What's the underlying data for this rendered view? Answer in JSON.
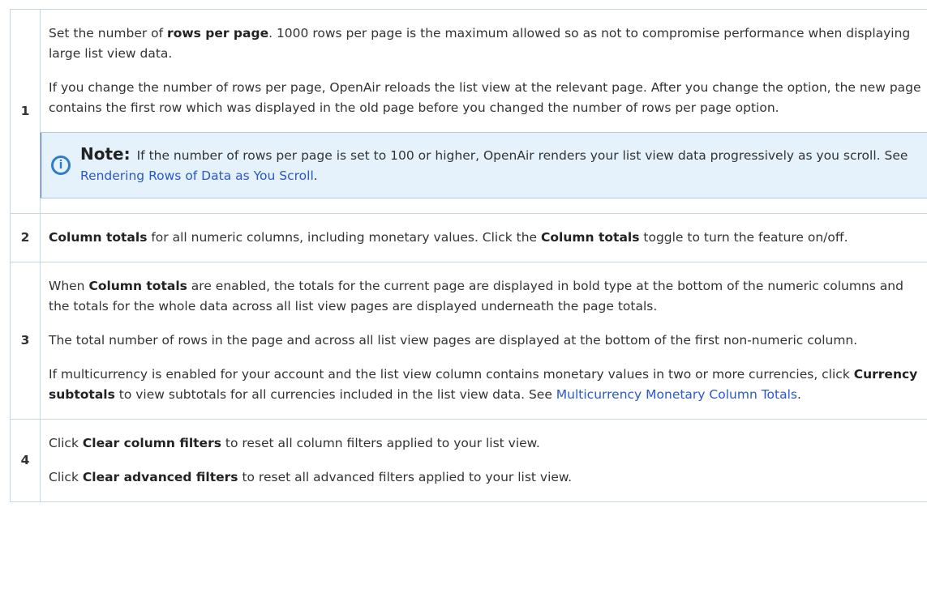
{
  "rows": [
    {
      "number": "1",
      "p1_pre": "Set the number of ",
      "p1_bold": "rows per page",
      "p1_post": ". 1000 rows per page is the maximum allowed so as not to compromise performance when displaying large list view data.",
      "p2": "If you change the number of rows per page, OpenAir reloads the list view at the relevant page. After you change the option, the new page contains the first row which was displayed in the old page before you changed the number of rows per page option.",
      "note": {
        "icon": "info-circle-icon",
        "label": "Note:",
        "text": "If the number of rows per page is set to 100 or higher, OpenAir renders your list view data progressively as you scroll. See ",
        "link": "Rendering Rows of Data as You Scroll",
        "end": "."
      }
    },
    {
      "number": "2",
      "bold1": "Column totals",
      "mid": " for all numeric columns, including monetary values. Click the ",
      "bold2": "Column totals",
      "post": " toggle to turn the feature on/off."
    },
    {
      "number": "3",
      "p1_pre": "When ",
      "p1_bold": "Column totals",
      "p1_post": " are enabled, the totals for the current page are displayed in bold type at the bottom of the numeric columns and the totals for the whole data across all list view pages are displayed underneath the page totals.",
      "p2": "The total number of rows in the page and across all list view pages are displayed at the bottom of the first non-numeric column.",
      "p3_pre": "If multicurrency is enabled for your account and the list view column contains monetary values in two or more currencies, click ",
      "p3_bold": "Currency subtotals",
      "p3_post": " to view subtotals for all currencies included in the list view data. See ",
      "p3_link": "Multicurrency Monetary Column Totals",
      "p3_end": "."
    },
    {
      "number": "4",
      "p1_pre": "Click ",
      "p1_bold": "Clear column filters",
      "p1_post": " to reset all column filters applied to your list view.",
      "p2_pre": "Click ",
      "p2_bold": "Clear advanced filters",
      "p2_post": " to reset all advanced filters applied to your list view."
    }
  ]
}
